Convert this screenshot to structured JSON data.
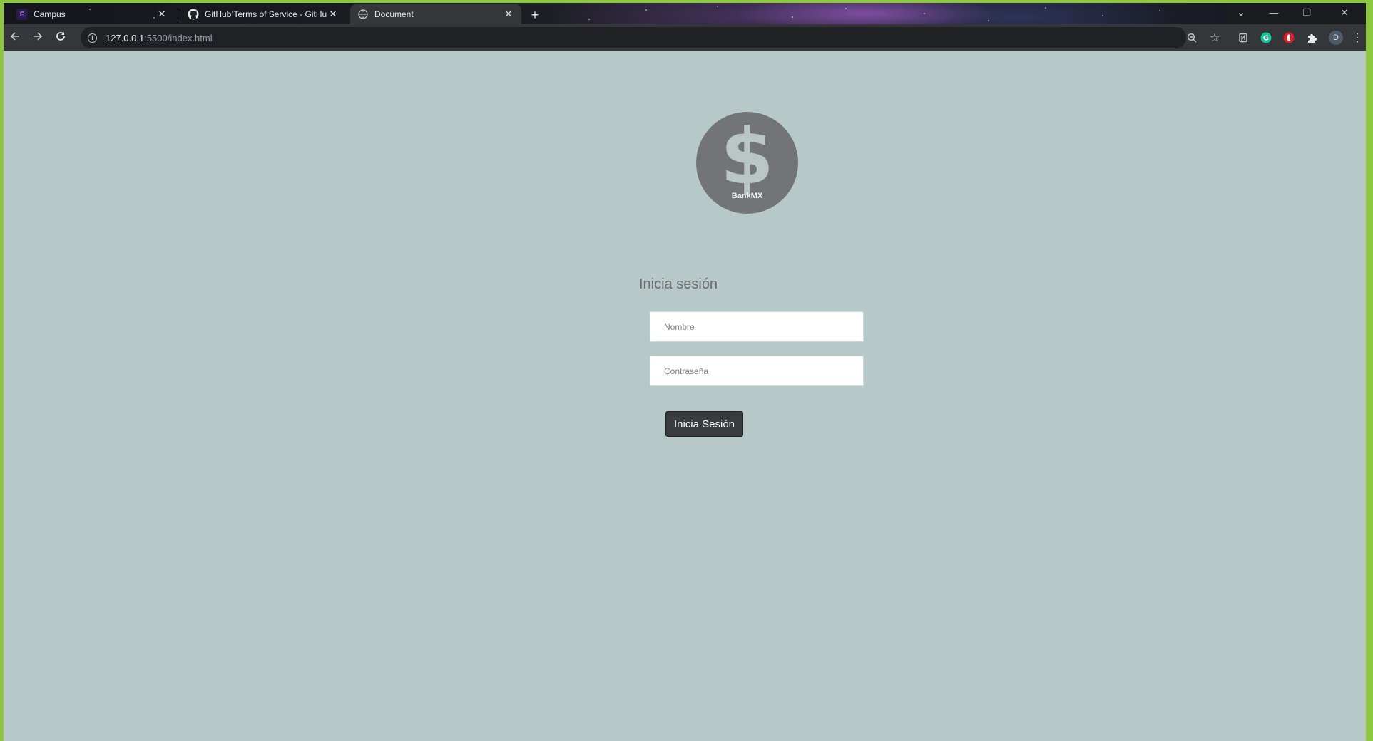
{
  "browser": {
    "tabs": [
      {
        "title": "Campus",
        "favicon": "campus-icon",
        "active": false
      },
      {
        "title": "GitHub Terms of Service - GitHub",
        "favicon": "github-icon",
        "active": false
      },
      {
        "title": "Document",
        "favicon": "globe-icon",
        "active": true
      }
    ],
    "new_tab_symbol": "+",
    "close_symbol": "✕",
    "address": {
      "host": "127.0.0.1",
      "rest": ":5500/index.html"
    },
    "profile_initial": "D",
    "window_controls": {
      "minimize": "—",
      "restore": "❐",
      "close": "✕",
      "tab_search": "⌄"
    },
    "colors": {
      "accent_green": "#1db954",
      "frame": "#202124",
      "toolbar": "#35363a"
    }
  },
  "page": {
    "background": "#b6c8c7",
    "logo": {
      "symbol": "$",
      "brand": "BankMX"
    },
    "login": {
      "heading": "Inicia sesión",
      "name_placeholder": "Nombre",
      "password_placeholder": "Contraseña",
      "submit_label": "Inicia Sesión"
    }
  }
}
